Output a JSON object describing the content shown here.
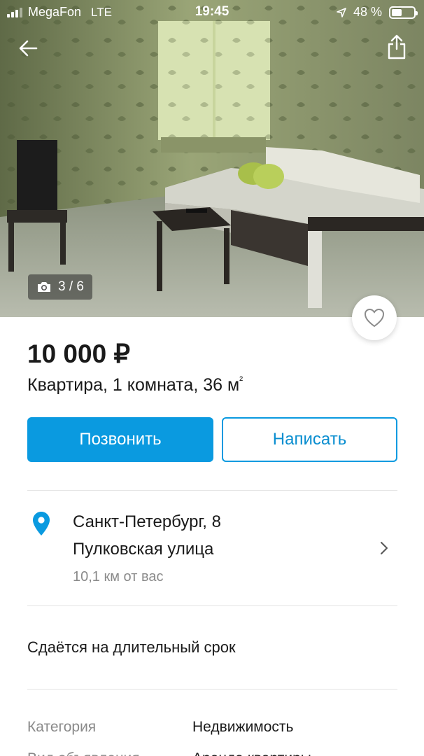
{
  "status_bar": {
    "carrier": "MegaFon",
    "network": "LTE",
    "time": "19:45",
    "battery_text": "48 %",
    "battery_level": 0.48
  },
  "photo": {
    "counter": "3 / 6",
    "counter_icon": "camera-icon"
  },
  "listing": {
    "price": "10 000 ₽",
    "subtitle_main": "Квартира, 1 комната, 36 м",
    "subtitle_sup": "²"
  },
  "actions": {
    "call_label": "Позвонить",
    "write_label": "Написать"
  },
  "address": {
    "line1": "Санкт-Петербург, 8",
    "line2": "Пулковская улица",
    "distance": "10,1  км от вас"
  },
  "description": "Сдаётся на длительный срок",
  "params": [
    {
      "label": "Категория",
      "value": "Недвижимость"
    },
    {
      "label": "Вид объявления",
      "value": "Аренда квартиры"
    }
  ],
  "colors": {
    "accent": "#0a9ae0",
    "text": "#1a1a1a",
    "muted": "#8a8a8a"
  }
}
